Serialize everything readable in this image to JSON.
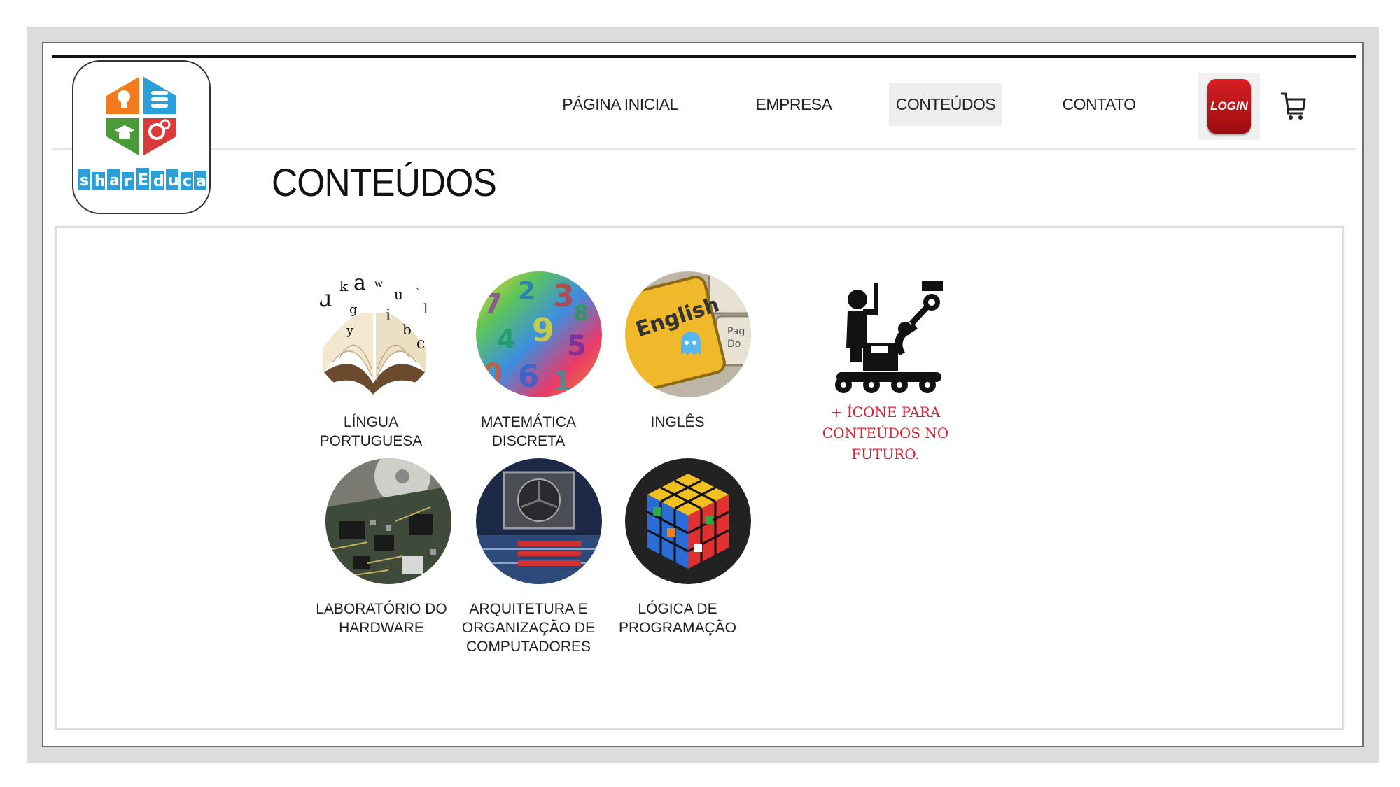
{
  "brand": {
    "logo_text": "sharEduca"
  },
  "nav": {
    "items": [
      {
        "label": "PÁGINA INICIAL"
      },
      {
        "label": "EMPRESA"
      },
      {
        "label": "CONTEÚDOS"
      },
      {
        "label": "CONTATO"
      }
    ],
    "active_index": 2,
    "login_label": "LOGIN"
  },
  "page": {
    "title": "CONTEÚDOS"
  },
  "courses": [
    {
      "label": "LÍNGUA\nPORTUGUESA",
      "icon": "open-book-letters-icon"
    },
    {
      "label": "MATEMÁTICA\nDISCRETA",
      "icon": "colorful-numbers-icon"
    },
    {
      "label": "INGLÊS",
      "icon": "english-keyboard-key-icon"
    },
    {
      "label": "LABORATÓRIO DO\nHARDWARE",
      "icon": "circuit-board-icon"
    },
    {
      "label": "ARQUITETURA E\nORGANIZAÇÃO DE\nCOMPUTADORES",
      "icon": "cpu-cooler-motherboard-icon"
    },
    {
      "label": "LÓGICA DE\nPROGRAMAÇÃO",
      "icon": "code-rubiks-cube-icon"
    }
  ],
  "future": {
    "label": "+ ÍCONE PARA\nCONTEÚDOS NO\nFUTURO.",
    "icon": "robot-arm-conveyor-icon"
  },
  "colors": {
    "login_red": "#c0151a",
    "future_text": "#e02030",
    "active_nav_bg": "#eeeeee"
  }
}
